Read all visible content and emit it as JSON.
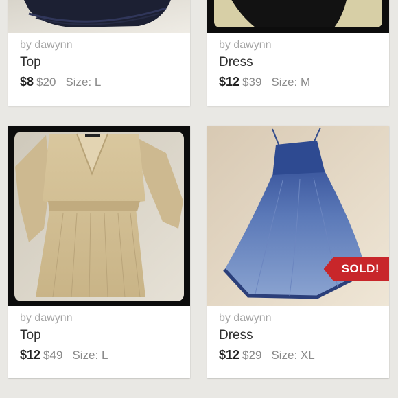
{
  "listings": [
    {
      "seller": "by dawynn",
      "title": "Top",
      "price": "$8",
      "original_price": "$20",
      "size": "Size: L",
      "sold": false
    },
    {
      "seller": "by dawynn",
      "title": "Dress",
      "price": "$12",
      "original_price": "$39",
      "size": "Size: M",
      "sold": false
    },
    {
      "seller": "by dawynn",
      "title": "Top",
      "price": "$12",
      "original_price": "$49",
      "size": "Size: L",
      "sold": false
    },
    {
      "seller": "by dawynn",
      "title": "Dress",
      "price": "$12",
      "original_price": "$29",
      "size": "Size: XL",
      "sold": true,
      "sold_label": "SOLD!"
    }
  ],
  "colors": {
    "background": "#e9e8e4",
    "sold_banner": "#c8262a",
    "card": "#ffffff"
  }
}
